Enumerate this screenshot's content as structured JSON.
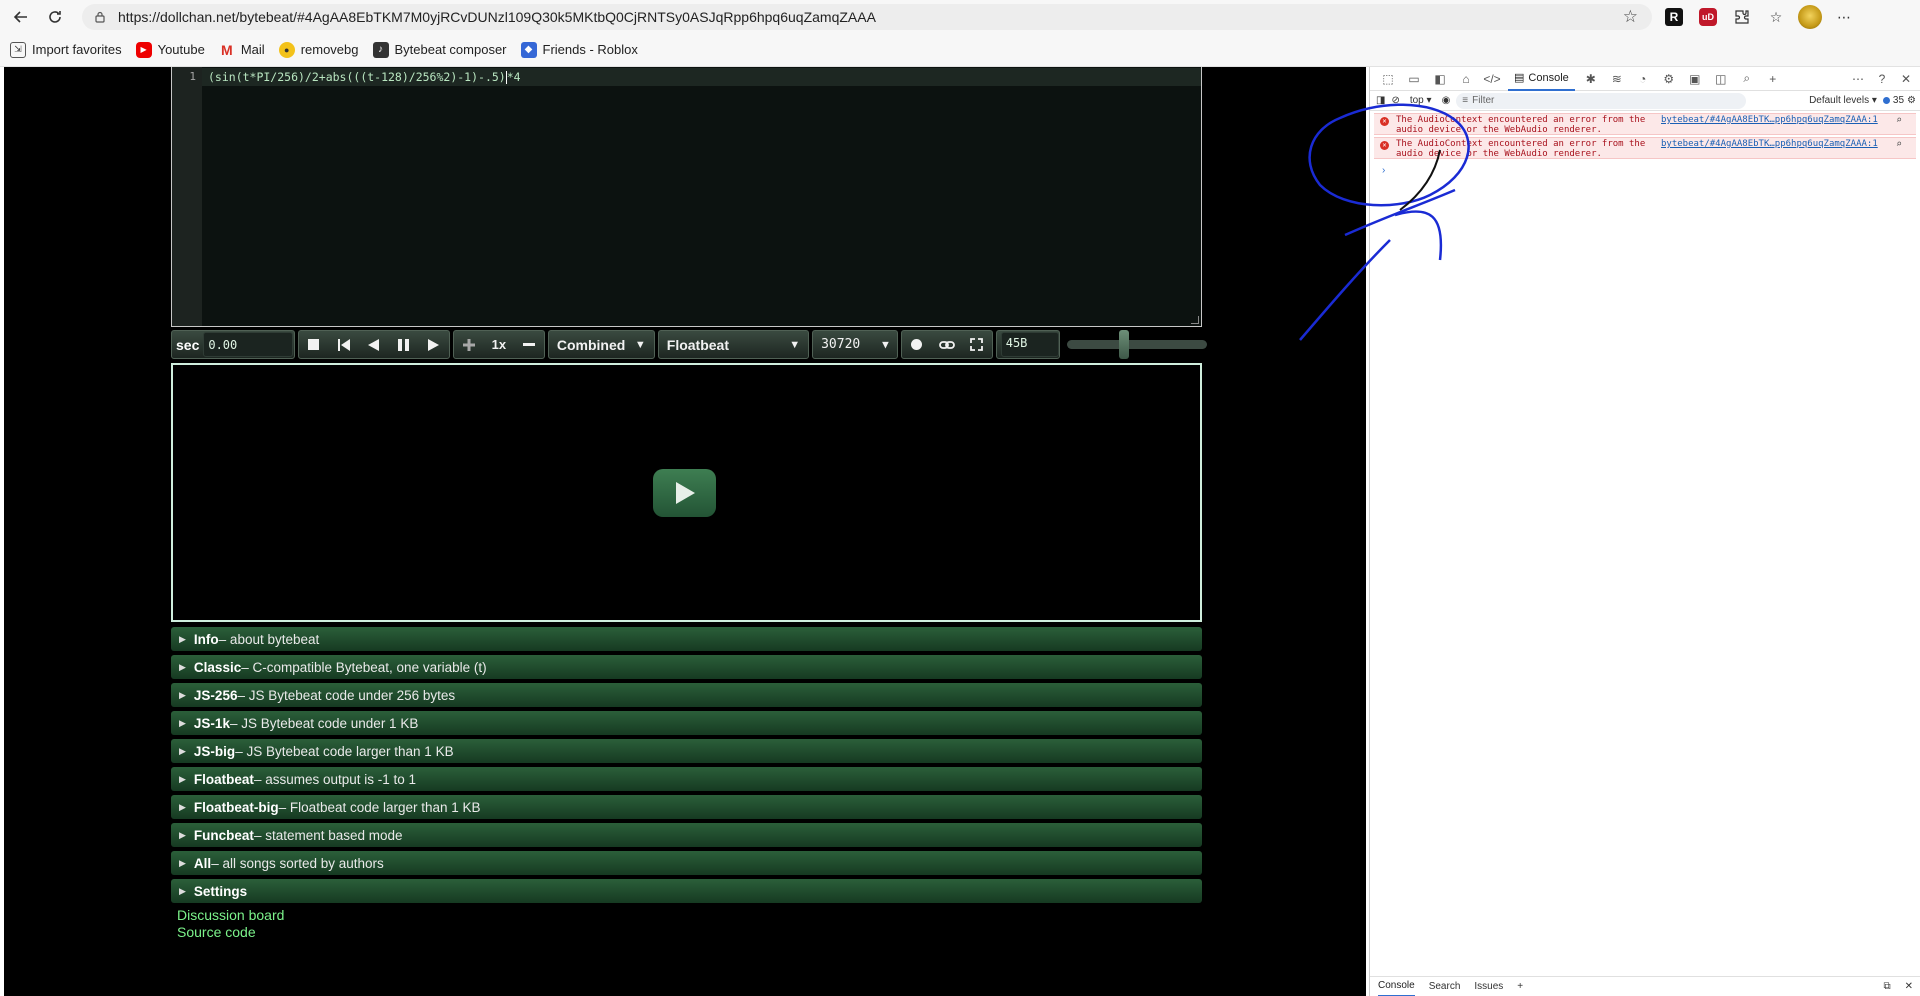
{
  "browser": {
    "url": "https://dollchan.net/bytebeat/#4AgAA8EbTKM7M0yjRCvDUNzl109Q30k5MKtbQ0CjRNTSy0ASJqRpp6hpq6uqZamqZAAA",
    "bookmarks": [
      {
        "label": "Import favorites",
        "icon": "import-icon"
      },
      {
        "label": "Youtube",
        "icon": "youtube-icon"
      },
      {
        "label": "Mail",
        "icon": "gmail-icon"
      },
      {
        "label": "removebg",
        "icon": "removebg-icon"
      },
      {
        "label": "Bytebeat composer",
        "icon": "bytebeat-icon"
      },
      {
        "label": "Friends - Roblox",
        "icon": "roblox-icon"
      }
    ],
    "ext_r": "R",
    "ext_ub": "uD"
  },
  "editor": {
    "line_number": "1",
    "code_before_cursor": "(sin(t*PI/256)/2+abs(((t-128)/256%2)-1)-.5)",
    "code_after_cursor": "*4"
  },
  "controls": {
    "time_label": "sec",
    "time_value": "0.00",
    "speed": "1x",
    "mode": "Combined",
    "type": "Floatbeat",
    "sample_rate": "30720",
    "code_size": "45B",
    "volume": 0.4
  },
  "sections": [
    {
      "name": "Info",
      "desc": " – about bytebeat"
    },
    {
      "name": "Classic",
      "desc": " – C-compatible Bytebeat, one variable (t)"
    },
    {
      "name": "JS-256",
      "desc": " – JS Bytebeat code under 256 bytes"
    },
    {
      "name": "JS-1k",
      "desc": " – JS Bytebeat code under 1 KB"
    },
    {
      "name": "JS-big",
      "desc": " – JS Bytebeat code larger than 1 KB"
    },
    {
      "name": "Floatbeat",
      "desc": " – assumes output is -1 to 1"
    },
    {
      "name": "Floatbeat-big",
      "desc": " – Floatbeat code larger than 1 KB"
    },
    {
      "name": "Funcbeat",
      "desc": " – statement based mode"
    },
    {
      "name": "All",
      "desc": " – all songs sorted by authors"
    },
    {
      "name": "Settings",
      "desc": ""
    }
  ],
  "links": {
    "discussion": "Discussion board",
    "source": "Source code"
  },
  "devtools": {
    "console_tab": "Console",
    "context": "top",
    "filter_placeholder": "Filter",
    "levels": "Default levels",
    "issues_count": "35",
    "errors": [
      {
        "line1": "The AudioContext encountered an error from the",
        "line2": "audio device or the WebAudio renderer.",
        "source": "bytebeat/#4AgAA8EbTK…pp6hpq6uqZamqZAAA:1"
      },
      {
        "line1": "The AudioContext encountered an error from the",
        "line2": "audio device or the WebAudio renderer.",
        "source": "bytebeat/#4AgAA8EbTK…pp6hpq6uqZamqZAAA:1"
      }
    ],
    "bottom_tabs": [
      "Console",
      "Search",
      "Issues"
    ]
  }
}
